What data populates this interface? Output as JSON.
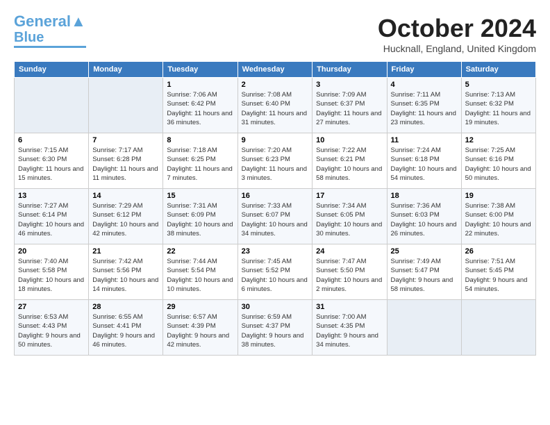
{
  "logo": {
    "line1": "General",
    "line2": "Blue"
  },
  "title": "October 2024",
  "location": "Hucknall, England, United Kingdom",
  "days_header": [
    "Sunday",
    "Monday",
    "Tuesday",
    "Wednesday",
    "Thursday",
    "Friday",
    "Saturday"
  ],
  "weeks": [
    [
      {
        "num": "",
        "info": ""
      },
      {
        "num": "",
        "info": ""
      },
      {
        "num": "1",
        "info": "Sunrise: 7:06 AM\nSunset: 6:42 PM\nDaylight: 11 hours and 36 minutes."
      },
      {
        "num": "2",
        "info": "Sunrise: 7:08 AM\nSunset: 6:40 PM\nDaylight: 11 hours and 31 minutes."
      },
      {
        "num": "3",
        "info": "Sunrise: 7:09 AM\nSunset: 6:37 PM\nDaylight: 11 hours and 27 minutes."
      },
      {
        "num": "4",
        "info": "Sunrise: 7:11 AM\nSunset: 6:35 PM\nDaylight: 11 hours and 23 minutes."
      },
      {
        "num": "5",
        "info": "Sunrise: 7:13 AM\nSunset: 6:32 PM\nDaylight: 11 hours and 19 minutes."
      }
    ],
    [
      {
        "num": "6",
        "info": "Sunrise: 7:15 AM\nSunset: 6:30 PM\nDaylight: 11 hours and 15 minutes."
      },
      {
        "num": "7",
        "info": "Sunrise: 7:17 AM\nSunset: 6:28 PM\nDaylight: 11 hours and 11 minutes."
      },
      {
        "num": "8",
        "info": "Sunrise: 7:18 AM\nSunset: 6:25 PM\nDaylight: 11 hours and 7 minutes."
      },
      {
        "num": "9",
        "info": "Sunrise: 7:20 AM\nSunset: 6:23 PM\nDaylight: 11 hours and 3 minutes."
      },
      {
        "num": "10",
        "info": "Sunrise: 7:22 AM\nSunset: 6:21 PM\nDaylight: 10 hours and 58 minutes."
      },
      {
        "num": "11",
        "info": "Sunrise: 7:24 AM\nSunset: 6:18 PM\nDaylight: 10 hours and 54 minutes."
      },
      {
        "num": "12",
        "info": "Sunrise: 7:25 AM\nSunset: 6:16 PM\nDaylight: 10 hours and 50 minutes."
      }
    ],
    [
      {
        "num": "13",
        "info": "Sunrise: 7:27 AM\nSunset: 6:14 PM\nDaylight: 10 hours and 46 minutes."
      },
      {
        "num": "14",
        "info": "Sunrise: 7:29 AM\nSunset: 6:12 PM\nDaylight: 10 hours and 42 minutes."
      },
      {
        "num": "15",
        "info": "Sunrise: 7:31 AM\nSunset: 6:09 PM\nDaylight: 10 hours and 38 minutes."
      },
      {
        "num": "16",
        "info": "Sunrise: 7:33 AM\nSunset: 6:07 PM\nDaylight: 10 hours and 34 minutes."
      },
      {
        "num": "17",
        "info": "Sunrise: 7:34 AM\nSunset: 6:05 PM\nDaylight: 10 hours and 30 minutes."
      },
      {
        "num": "18",
        "info": "Sunrise: 7:36 AM\nSunset: 6:03 PM\nDaylight: 10 hours and 26 minutes."
      },
      {
        "num": "19",
        "info": "Sunrise: 7:38 AM\nSunset: 6:00 PM\nDaylight: 10 hours and 22 minutes."
      }
    ],
    [
      {
        "num": "20",
        "info": "Sunrise: 7:40 AM\nSunset: 5:58 PM\nDaylight: 10 hours and 18 minutes."
      },
      {
        "num": "21",
        "info": "Sunrise: 7:42 AM\nSunset: 5:56 PM\nDaylight: 10 hours and 14 minutes."
      },
      {
        "num": "22",
        "info": "Sunrise: 7:44 AM\nSunset: 5:54 PM\nDaylight: 10 hours and 10 minutes."
      },
      {
        "num": "23",
        "info": "Sunrise: 7:45 AM\nSunset: 5:52 PM\nDaylight: 10 hours and 6 minutes."
      },
      {
        "num": "24",
        "info": "Sunrise: 7:47 AM\nSunset: 5:50 PM\nDaylight: 10 hours and 2 minutes."
      },
      {
        "num": "25",
        "info": "Sunrise: 7:49 AM\nSunset: 5:47 PM\nDaylight: 9 hours and 58 minutes."
      },
      {
        "num": "26",
        "info": "Sunrise: 7:51 AM\nSunset: 5:45 PM\nDaylight: 9 hours and 54 minutes."
      }
    ],
    [
      {
        "num": "27",
        "info": "Sunrise: 6:53 AM\nSunset: 4:43 PM\nDaylight: 9 hours and 50 minutes."
      },
      {
        "num": "28",
        "info": "Sunrise: 6:55 AM\nSunset: 4:41 PM\nDaylight: 9 hours and 46 minutes."
      },
      {
        "num": "29",
        "info": "Sunrise: 6:57 AM\nSunset: 4:39 PM\nDaylight: 9 hours and 42 minutes."
      },
      {
        "num": "30",
        "info": "Sunrise: 6:59 AM\nSunset: 4:37 PM\nDaylight: 9 hours and 38 minutes."
      },
      {
        "num": "31",
        "info": "Sunrise: 7:00 AM\nSunset: 4:35 PM\nDaylight: 9 hours and 34 minutes."
      },
      {
        "num": "",
        "info": ""
      },
      {
        "num": "",
        "info": ""
      }
    ]
  ]
}
